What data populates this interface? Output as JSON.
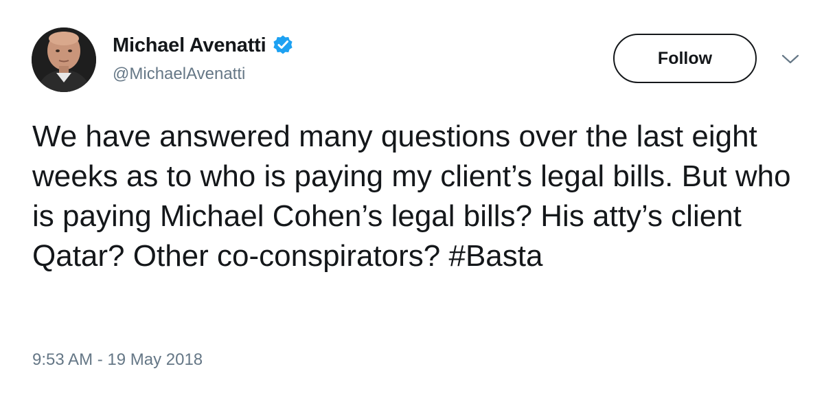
{
  "user": {
    "display_name": "Michael Avenatti",
    "handle": "@MichaelAvenatti",
    "verified_icon": "verified-badge-icon",
    "avatar_icon": "profile-photo"
  },
  "actions": {
    "follow_label": "Follow",
    "menu_icon": "chevron-down-icon"
  },
  "tweet": {
    "text_main": "We have answered many questions over the last eight weeks as to who is paying my client’s legal bills. But who is paying Michael Cohen’s legal bills? His atty’s client Qatar? Other co-conspirators? ",
    "hashtag": "#Basta",
    "timestamp": "9:53 AM - 19 May 2018"
  },
  "colors": {
    "text": "#14171a",
    "secondary": "#657786",
    "verified_blue": "#1da1f2"
  }
}
